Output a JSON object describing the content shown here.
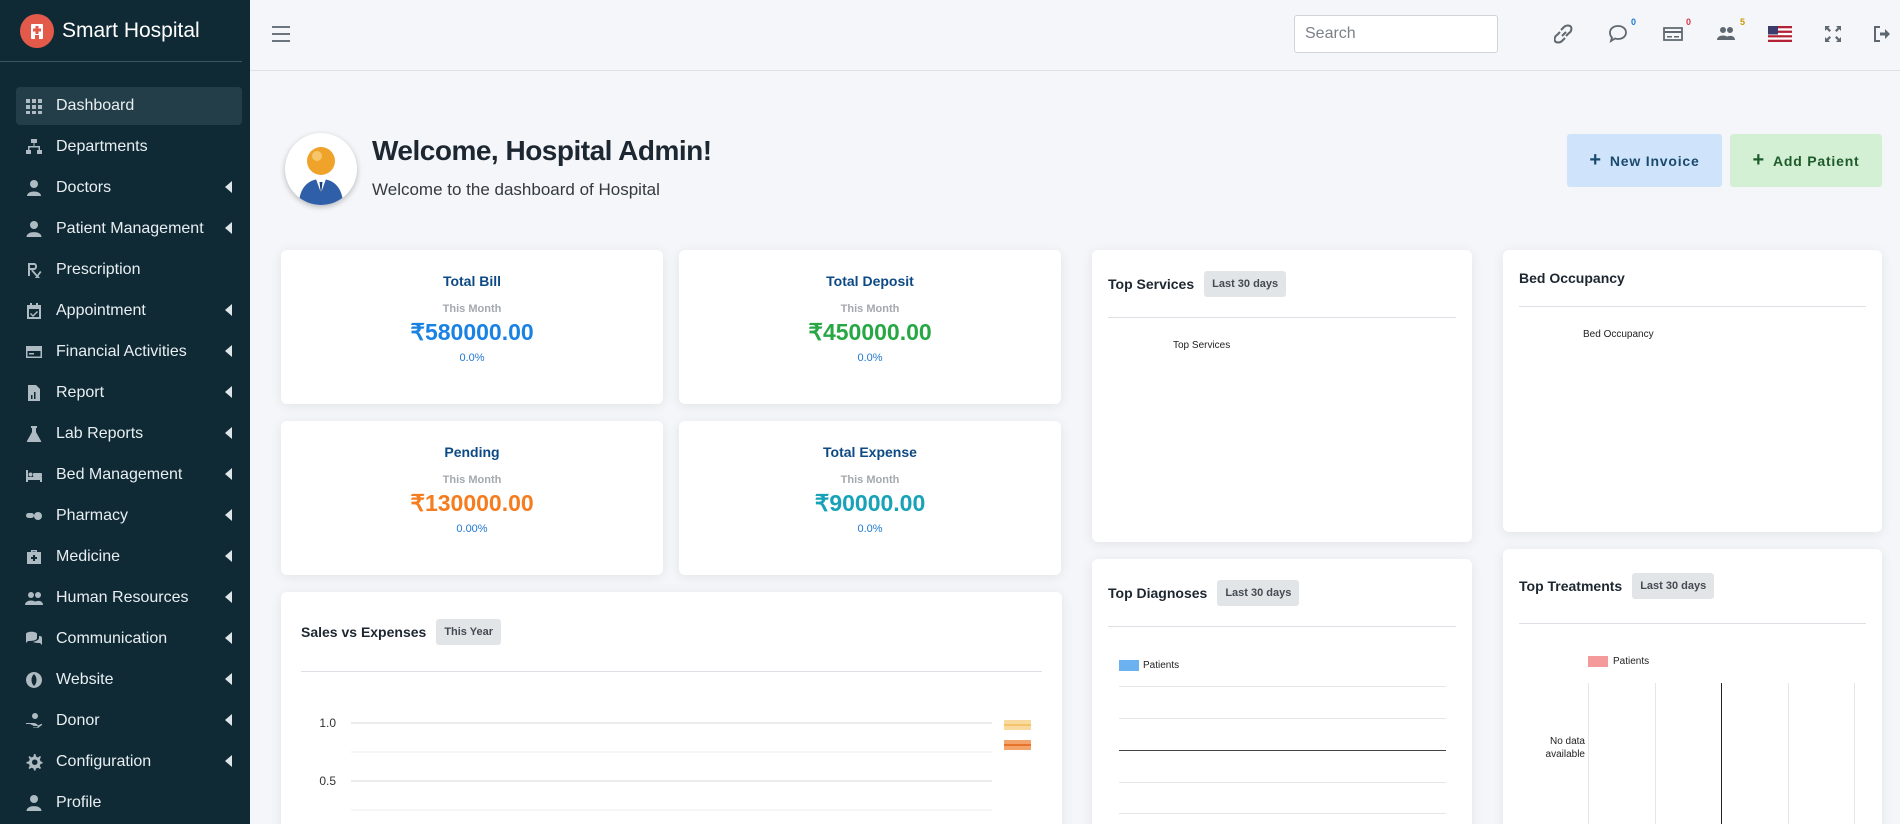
{
  "brand": {
    "title": "Smart Hospital"
  },
  "sidebar": {
    "items": [
      {
        "label": "Dashboard",
        "icon": "dashboard-icon",
        "caret": false,
        "active": true
      },
      {
        "label": "Departments",
        "icon": "sitemap-icon",
        "caret": false
      },
      {
        "label": "Doctors",
        "icon": "doctor-icon",
        "caret": true
      },
      {
        "label": "Patient Management",
        "icon": "user-icon",
        "caret": true
      },
      {
        "label": "Prescription",
        "icon": "prescription-icon",
        "caret": false
      },
      {
        "label": "Appointment",
        "icon": "calendar-check-icon",
        "caret": true
      },
      {
        "label": "Financial Activities",
        "icon": "credit-card-icon",
        "caret": true
      },
      {
        "label": "Report",
        "icon": "file-chart-icon",
        "caret": true
      },
      {
        "label": "Lab Reports",
        "icon": "flask-icon",
        "caret": true
      },
      {
        "label": "Bed Management",
        "icon": "bed-icon",
        "caret": true
      },
      {
        "label": "Pharmacy",
        "icon": "pills-icon",
        "caret": true
      },
      {
        "label": "Medicine",
        "icon": "medkit-icon",
        "caret": true
      },
      {
        "label": "Human Resources",
        "icon": "users-icon",
        "caret": true
      },
      {
        "label": "Communication",
        "icon": "comments-icon",
        "caret": true
      },
      {
        "label": "Website",
        "icon": "globe-icon",
        "caret": true
      },
      {
        "label": "Donor",
        "icon": "hand-holding-icon",
        "caret": true
      },
      {
        "label": "Configuration",
        "icon": "cog-icon",
        "caret": true
      },
      {
        "label": "Profile",
        "icon": "user-icon",
        "caret": false
      }
    ]
  },
  "topbar": {
    "search_placeholder": "Search",
    "icons": [
      {
        "name": "link-icon",
        "badge": ""
      },
      {
        "name": "chat-icon",
        "badge": "0",
        "badge_color": "#1f78d1"
      },
      {
        "name": "billing-icon",
        "badge": "0",
        "badge_color": "#dc3545"
      },
      {
        "name": "users-icon",
        "badge": "5",
        "badge_color": "#c79a00"
      },
      {
        "name": "us-flag-icon",
        "badge": ""
      },
      {
        "name": "expand-icon",
        "badge": ""
      },
      {
        "name": "logout-icon",
        "badge": ""
      }
    ]
  },
  "welcome": {
    "title": "Welcome, Hospital Admin!",
    "subtitle": "Welcome to the dashboard of Hospital",
    "new_invoice": "New Invoice",
    "add_patient": "Add Patient"
  },
  "stats": [
    {
      "title": "Total Bill",
      "period": "This Month",
      "value": "₹580000.00",
      "change": "0.0%",
      "color": "#1a82e2"
    },
    {
      "title": "Total Deposit",
      "period": "This Month",
      "value": "₹450000.00",
      "change": "0.0%",
      "color": "#28a745"
    },
    {
      "title": "Pending",
      "period": "This Month",
      "value": "₹130000.00",
      "change": "0.00%",
      "color": "#f57c1f"
    },
    {
      "title": "Total Expense",
      "period": "This Month",
      "value": "₹90000.00",
      "change": "0.0%",
      "color": "#17a2b8"
    }
  ],
  "panels": {
    "top_services": {
      "title": "Top Services",
      "tag": "Last 30 days",
      "chart_label": "Top Services"
    },
    "bed_occupancy": {
      "title": "Bed Occupancy",
      "chart_label": "Bed Occupancy"
    },
    "sales_expenses": {
      "title": "Sales vs Expenses",
      "tag": "This Year"
    },
    "top_diagnoses": {
      "title": "Top Diagnoses",
      "tag": "Last 30 days",
      "legend": "Patients"
    },
    "top_treatments": {
      "title": "Top Treatments",
      "tag": "Last 30 days",
      "legend": "Patients",
      "no_data": "No data available"
    }
  },
  "chart_data": [
    {
      "type": "line",
      "title": "Sales vs Expenses",
      "yticks": [
        "1.0",
        "0.5"
      ],
      "series": [],
      "legend_colors": [
        "#f8d9a0",
        "#f3a46a"
      ]
    },
    {
      "type": "bar",
      "title": "Top Diagnoses",
      "series": [
        {
          "name": "Patients",
          "values": []
        }
      ],
      "color": "#6cb2f0"
    },
    {
      "type": "bar",
      "title": "Top Treatments",
      "series": [
        {
          "name": "Patients",
          "values": []
        }
      ],
      "color": "#f59a9a"
    }
  ]
}
